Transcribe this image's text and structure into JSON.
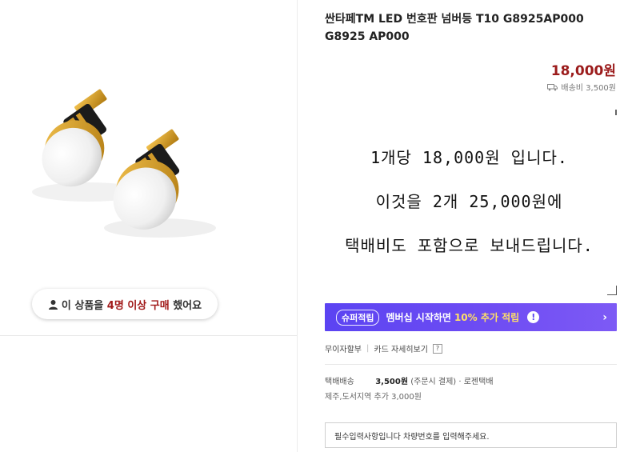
{
  "product": {
    "title": "싼타페TM LED 번호판 넘버등 T10 G8925AP000 G8925 AP000",
    "price": "18,000원",
    "shipping_summary": "배송비 3,500원"
  },
  "buyers": {
    "prefix": "이 상품을",
    "count": "4명 이상",
    "action": "구매",
    "suffix": "했어요"
  },
  "description": {
    "line1": "1개당 18,000원 입니다.",
    "line2": "이것을 2개 25,000원에",
    "line3": "택배비도 포함으로 보내드립니다."
  },
  "promo": {
    "badge": "슈퍼적립",
    "text_before": "멤버십 시작하면",
    "highlight": "10% 추가 적립",
    "info": "!",
    "chevron": "›"
  },
  "installment": {
    "free_label": "무이자할부",
    "card_label": "카드 자세히보기",
    "help": "?"
  },
  "shipping": {
    "label": "택배배송",
    "fee": "3,500원",
    "detail": "(주문시 결제) · 로젠택배",
    "extra": "제주,도서지역 추가 3,000원"
  },
  "required_input": {
    "text": "필수입력사항입니다 차량번호를 입력해주세요."
  },
  "colors": {
    "price": "#9b1b1b",
    "promo_bg": "#5b44f2",
    "promo_highlight": "#ffe066"
  },
  "icons": {
    "buyer": "person-icon",
    "shipping": "truck-icon",
    "promo_info": "info-icon",
    "promo_arrow": "chevron-right-icon",
    "card_help": "help-icon"
  }
}
